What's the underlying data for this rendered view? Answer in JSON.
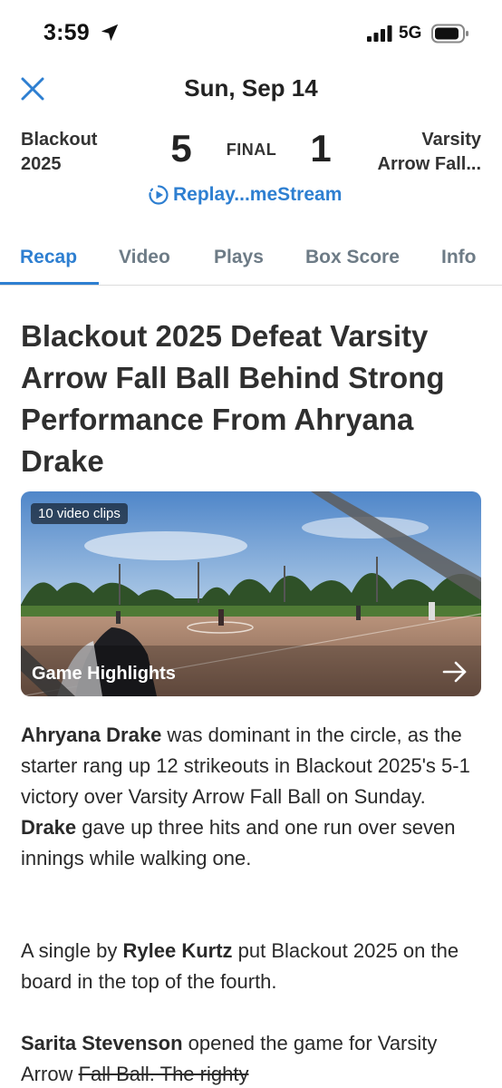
{
  "status_bar": {
    "time": "3:59",
    "network": "5G",
    "icons": [
      "location-arrow-icon",
      "signal-bars-icon",
      "battery-icon"
    ]
  },
  "header": {
    "date": "Sun, Sep 14",
    "close_icon": "close-icon"
  },
  "scoreboard": {
    "home_team_line1": "Blackout",
    "home_team_line2": "2025",
    "home_score": "5",
    "status": "FINAL",
    "away_score": "1",
    "away_team_line1": "Varsity",
    "away_team_line2": "Arrow Fall...",
    "replay_label": "Replay...meStream"
  },
  "tabs": [
    {
      "label": "Recap",
      "active": true
    },
    {
      "label": "Video",
      "active": false
    },
    {
      "label": "Plays",
      "active": false
    },
    {
      "label": "Box Score",
      "active": false
    },
    {
      "label": "Info",
      "active": false
    }
  ],
  "article": {
    "headline": "Blackout 2025 Defeat Varsity Arrow Fall Ball Behind Strong Performance From Ahryana Drake",
    "highlights": {
      "clips_badge": "10 video clips",
      "title": "Game Highlights"
    },
    "p1": {
      "bold1": "Ahryana Drake",
      "text1": " was dominant in the circle, as the starter rang up 12 strikeouts in Blackout 2025's 5-1 victory over Varsity Arrow Fall Ball on Sunday. ",
      "bold2": "Drake",
      "text2": " gave up three hits and one run over seven innings while walking one."
    },
    "p2": {
      "text1": "A single by ",
      "bold1": "Rylee Kurtz",
      "text2": " put Blackout 2025 on the board in the top of the fourth."
    },
    "p3": {
      "bold1": "Sarita Stevenson",
      "text1": " opened the game for Varsity Arrow ",
      "struck": "Fall Ball. The righty",
      "text2": ""
    }
  },
  "colors": {
    "accent_blue": "#2e7fd1",
    "tab_inactive": "#6d7b86",
    "text": "#2b2b2b"
  }
}
